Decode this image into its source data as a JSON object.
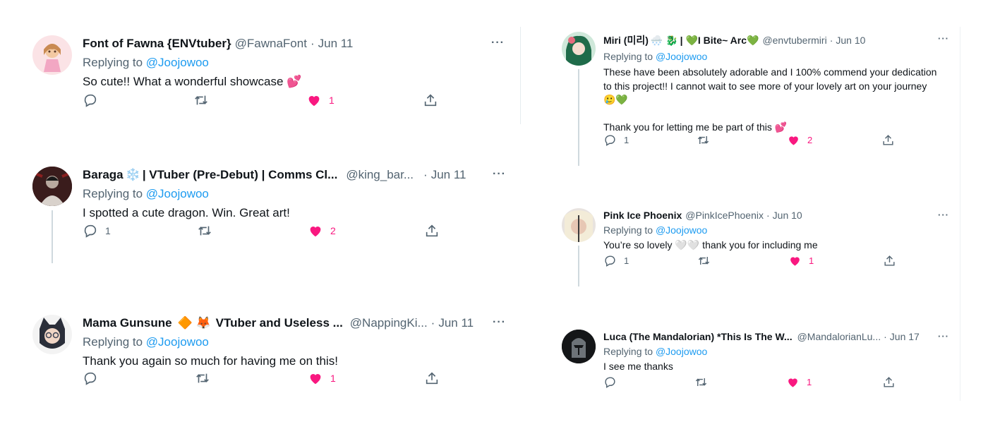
{
  "tweets": [
    {
      "name": "Font of Fawna {ENVtuber}",
      "handle": "@FawnaFont",
      "date": "Jun 11",
      "replying_label": "Replying to",
      "replying_to": "@Joojowoo",
      "text": "So cute!! What a wonderful showcase",
      "text_emoji": "💕",
      "replies": "",
      "retweets": "",
      "likes": "1",
      "liked": true,
      "more": "···"
    },
    {
      "name": "Baraga",
      "name_emoji": "❄️",
      "name_rest": "| VTuber (Pre-Debut) | Comms Cl...",
      "handle": "@king_bar...",
      "date": "Jun 11",
      "replying_label": "Replying to",
      "replying_to": "@Joojowoo",
      "text": "I spotted a cute dragon. Win. Great art!",
      "replies": "1",
      "retweets": "",
      "likes": "2",
      "liked": true,
      "more": "···"
    },
    {
      "name": "Mama Gunsune",
      "name_emoji": "🔶 🦊",
      "name_rest": "VTuber and Useless ...",
      "handle": "@NappingKi...",
      "date": "Jun 11",
      "replying_label": "Replying to",
      "replying_to": "@Joojowoo",
      "text": "Thank you again so much for having me on this!",
      "replies": "",
      "retweets": "",
      "likes": "1",
      "liked": true,
      "more": "···"
    },
    {
      "name": "Miri (미리)",
      "name_emoji": "🌨️ 🐉",
      "name_rest": "| 💚I Bite~ Arc💚",
      "handle": "@envtubermiri",
      "date": "Jun 10",
      "replying_label": "Replying to",
      "replying_to": "@Joojowoo",
      "text_lines": [
        "These have been absolutely adorable and I 100% commend your dedication",
        "to this project!! I cannot wait to see more of your lovely art on your journey",
        "🥲💚",
        "",
        "Thank you for letting me be part of this 💕"
      ],
      "replies": "1",
      "retweets": "",
      "likes": "2",
      "liked": true,
      "more": "···"
    },
    {
      "name": "Pink Ice Phoenix",
      "handle": "@PinkIcePhoenix",
      "date": "Jun 10",
      "replying_label": "Replying to",
      "replying_to": "@Joojowoo",
      "text": "You’re so lovely 🤍🤍 thank you for including me",
      "replies": "1",
      "retweets": "",
      "likes": "1",
      "liked": true,
      "more": "···"
    },
    {
      "name": "Luca (The Mandalorian) *This Is The W...",
      "handle": "@MandalorianLu...",
      "date": "Jun 17",
      "replying_label": "Replying to",
      "replying_to": "@Joojowoo",
      "text": "I see me thanks",
      "replies": "",
      "retweets": "",
      "likes": "1",
      "liked": true,
      "more": "···"
    }
  ],
  "dot": "·",
  "colors": {
    "link": "#1d9bf0",
    "muted": "#536471",
    "like": "#f91880",
    "text": "#0f1419"
  },
  "icons": {
    "reply": "reply-icon",
    "retweet": "retweet-icon",
    "like": "heart-icon",
    "share": "share-icon",
    "more": "more-icon"
  }
}
